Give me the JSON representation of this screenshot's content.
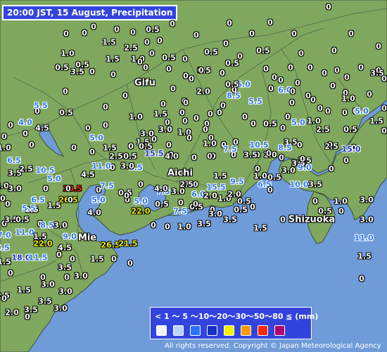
{
  "title": "20:00 JST, 15 August, Precipitation",
  "legend": {
    "text": "< 1 ～ 5 ～10～20～30～50～80 ≦ (mm)",
    "colors": [
      "#f4f4f4",
      "#b9d4ff",
      "#2b74ff",
      "#1830c8",
      "#f5f000",
      "#ff9900",
      "#ff2800",
      "#b4006e"
    ]
  },
  "copyright": "All rights reserved. Copyright © Japan Meteorological Agency",
  "colors": {
    "sea": "#6f9bd8",
    "land": "#7fa85e",
    "border": "#55674a"
  },
  "cities": [
    "Gifu",
    "Aichi",
    "Mie",
    "Shizuoka"
  ],
  "observations": [
    {
      "v": "0",
      "c": "c0"
    },
    {
      "v": "0",
      "c": "c0"
    },
    {
      "v": "0",
      "c": "c0"
    },
    {
      "v": "0",
      "c": "c0"
    },
    {
      "v": "0",
      "c": "c0"
    },
    {
      "v": "0",
      "c": "c0"
    },
    {
      "v": "0",
      "c": "c0"
    },
    {
      "v": "0",
      "c": "c0"
    },
    {
      "v": "1.5",
      "c": "c0"
    },
    {
      "v": "0",
      "c": "c0"
    },
    {
      "v": "0",
      "c": "c0"
    },
    {
      "v": "0.5",
      "c": "c0"
    },
    {
      "v": "0",
      "c": "c0"
    },
    {
      "v": "0",
      "c": "c0"
    },
    {
      "v": "0",
      "c": "c0"
    },
    {
      "v": "0",
      "c": "c0"
    },
    {
      "v": "0",
      "c": "c0"
    },
    {
      "v": "0",
      "c": "c0"
    },
    {
      "v": "1.0",
      "c": "c0"
    },
    {
      "v": "2.5",
      "c": "c0"
    },
    {
      "v": "0",
      "c": "c0"
    },
    {
      "v": "0.5",
      "c": "c0"
    },
    {
      "v": "0",
      "c": "c0"
    },
    {
      "v": "0.5",
      "c": "c0"
    },
    {
      "v": "0",
      "c": "c0"
    },
    {
      "v": "0",
      "c": "c0"
    },
    {
      "v": "0",
      "c": "c0"
    },
    {
      "v": "0.5",
      "c": "c0"
    },
    {
      "v": "0.5",
      "c": "c0"
    },
    {
      "v": "1.5",
      "c": "c0"
    },
    {
      "v": "1.0",
      "c": "c0"
    },
    {
      "v": "0",
      "c": "c0"
    },
    {
      "v": "0",
      "c": "c0"
    },
    {
      "v": "0",
      "c": "c0"
    },
    {
      "v": "0",
      "c": "c0"
    },
    {
      "v": "0.5",
      "c": "c0"
    },
    {
      "v": "0.5",
      "c": "c0"
    },
    {
      "v": "0",
      "c": "c0"
    },
    {
      "v": "0",
      "c": "c0"
    },
    {
      "v": "0",
      "c": "c0"
    },
    {
      "v": "0",
      "c": "c0"
    },
    {
      "v": "0",
      "c": "c0"
    },
    {
      "v": "0",
      "c": "c0"
    },
    {
      "v": "0",
      "c": "c0"
    },
    {
      "v": "0",
      "c": "c0"
    },
    {
      "v": "0",
      "c": "c0"
    },
    {
      "v": "0",
      "c": "c0"
    },
    {
      "v": "0",
      "c": "c0"
    },
    {
      "v": "0",
      "c": "c0"
    },
    {
      "v": "6.0",
      "c": "c5"
    },
    {
      "v": "6.0",
      "c": "c5"
    },
    {
      "v": "0",
      "c": "c0"
    },
    {
      "v": "5.5",
      "c": "c5"
    },
    {
      "v": "0",
      "c": "c0"
    },
    {
      "v": "0",
      "c": "c0"
    },
    {
      "v": "3.5",
      "c": "c0"
    },
    {
      "v": "0",
      "c": "c0"
    },
    {
      "v": "0.5",
      "c": "c0"
    },
    {
      "v": "0",
      "c": "c0"
    },
    {
      "v": "0",
      "c": "c0"
    },
    {
      "v": "0",
      "c": "c0"
    },
    {
      "v": "0",
      "c": "c0"
    },
    {
      "v": "0",
      "c": "c0"
    },
    {
      "v": "0",
      "c": "c0"
    },
    {
      "v": "0",
      "c": "c0"
    },
    {
      "v": "0.5",
      "c": "c0"
    },
    {
      "v": "3.5",
      "c": "c0"
    },
    {
      "v": "0",
      "c": "c0"
    },
    {
      "v": "0",
      "c": "c0"
    },
    {
      "v": "0",
      "c": "c0"
    },
    {
      "v": "0",
      "c": "c0"
    },
    {
      "v": "2.0",
      "c": "c0"
    },
    {
      "v": "8.5",
      "c": "c5"
    },
    {
      "v": "0",
      "c": "c0"
    },
    {
      "v": "0",
      "c": "c0"
    },
    {
      "v": "0",
      "c": "c0"
    },
    {
      "v": "0",
      "c": "c0"
    },
    {
      "v": "0",
      "c": "c0"
    },
    {
      "v": "1.0",
      "c": "c0"
    },
    {
      "v": "0",
      "c": "c0"
    },
    {
      "v": "0",
      "c": "c0"
    },
    {
      "v": "0",
      "c": "c0"
    },
    {
      "v": "0",
      "c": "c0"
    },
    {
      "v": "0.5",
      "c": "c0"
    },
    {
      "v": "0",
      "c": "c0"
    },
    {
      "v": "0",
      "c": "c0"
    },
    {
      "v": "1.5",
      "c": "c0"
    },
    {
      "v": "0",
      "c": "c0"
    },
    {
      "v": "0",
      "c": "c0"
    },
    {
      "v": "0",
      "c": "c0"
    },
    {
      "v": "0",
      "c": "c0"
    },
    {
      "v": "0",
      "c": "c0"
    },
    {
      "v": "0",
      "c": "c0"
    },
    {
      "v": "5.0",
      "c": "c5"
    },
    {
      "v": "5.5",
      "c": "c5"
    },
    {
      "v": "1.0",
      "c": "c0"
    },
    {
      "v": "0",
      "c": "c0"
    },
    {
      "v": "0",
      "c": "c0"
    },
    {
      "v": "0",
      "c": "c0"
    },
    {
      "v": "0",
      "c": "c0"
    },
    {
      "v": "0",
      "c": "c0"
    },
    {
      "v": "0",
      "c": "c0"
    },
    {
      "v": "0",
      "c": "c0"
    },
    {
      "v": "5.0",
      "c": "c5"
    },
    {
      "v": "1.0",
      "c": "c0"
    },
    {
      "v": "2.5",
      "c": "c0"
    },
    {
      "v": "0.5",
      "c": "c0"
    },
    {
      "v": "1.5",
      "c": "c0"
    },
    {
      "v": "0",
      "c": "c0"
    },
    {
      "v": "0",
      "c": "c0"
    },
    {
      "v": "4.0",
      "c": "c5"
    },
    {
      "v": "0",
      "c": "c0"
    },
    {
      "v": "0",
      "c": "c0"
    },
    {
      "v": "3.0",
      "c": "c0"
    },
    {
      "v": "3.0",
      "c": "c0"
    },
    {
      "v": "1.0",
      "c": "c0"
    },
    {
      "v": "0",
      "c": "c0"
    },
    {
      "v": "0",
      "c": "c0"
    },
    {
      "v": "0.5",
      "c": "c0"
    },
    {
      "v": "0",
      "c": "c0"
    },
    {
      "v": "0",
      "c": "c0"
    },
    {
      "v": "4.5",
      "c": "c0"
    },
    {
      "v": "1.5",
      "c": "c0"
    },
    {
      "v": "0.5",
      "c": "c0"
    },
    {
      "v": "0",
      "c": "c0"
    },
    {
      "v": "0",
      "c": "c0"
    },
    {
      "v": "0",
      "c": "c0"
    },
    {
      "v": "0",
      "c": "c0"
    },
    {
      "v": "0",
      "c": "c0"
    },
    {
      "v": "2.5",
      "c": "c0"
    },
    {
      "v": "0",
      "c": "c0"
    },
    {
      "v": "0",
      "c": "c0"
    },
    {
      "v": "5.0",
      "c": "c5"
    },
    {
      "v": "1.5",
      "c": "c0"
    },
    {
      "v": "0",
      "c": "c0"
    },
    {
      "v": "0",
      "c": "c0"
    },
    {
      "v": "0",
      "c": "c0"
    },
    {
      "v": "1.0",
      "c": "c0"
    },
    {
      "v": "0",
      "c": "c0"
    },
    {
      "v": "0",
      "c": "c0"
    },
    {
      "v": "10.5",
      "c": "c5"
    },
    {
      "v": "3.5",
      "c": "c0"
    },
    {
      "v": "0",
      "c": "c0"
    },
    {
      "v": "2.5",
      "c": "c0"
    },
    {
      "v": "0",
      "c": "c0"
    },
    {
      "v": "0",
      "c": "c0"
    },
    {
      "v": "0",
      "c": "c0"
    },
    {
      "v": "2.5",
      "c": "c0"
    },
    {
      "v": "0.5",
      "c": "c0"
    },
    {
      "v": "0",
      "c": "c0"
    },
    {
      "v": "0",
      "c": "c0"
    },
    {
      "v": "0",
      "c": "c0"
    },
    {
      "v": "7.5",
      "c": "c5"
    },
    {
      "v": "3.5",
      "c": "c0"
    },
    {
      "v": "1.0",
      "c": "c0"
    },
    {
      "v": "8.5",
      "c": "c5"
    },
    {
      "v": "3.5",
      "c": "c0"
    },
    {
      "v": "15.0",
      "c": "c10"
    },
    {
      "v": "1.0",
      "c": "c0"
    },
    {
      "v": "0",
      "c": "c0"
    },
    {
      "v": "6.5",
      "c": "c5"
    },
    {
      "v": "0",
      "c": "c0"
    },
    {
      "v": "9.5",
      "c": "c5"
    },
    {
      "v": "15.5",
      "c": "c10"
    },
    {
      "v": "4.0",
      "c": "c0"
    },
    {
      "v": "3.5",
      "c": "c0"
    },
    {
      "v": "2.5",
      "c": "c0"
    },
    {
      "v": "10.5",
      "c": "c5"
    },
    {
      "v": "5.0",
      "c": "c5"
    },
    {
      "v": "30.5",
      "c": "c50"
    },
    {
      "v": "3.0",
      "c": "c0"
    },
    {
      "v": "0",
      "c": "c0"
    },
    {
      "v": "0",
      "c": "c0"
    },
    {
      "v": "0",
      "c": "c0"
    },
    {
      "v": "0",
      "c": "c0"
    },
    {
      "v": "11.0",
      "c": "c5"
    },
    {
      "v": "4.5",
      "c": "c0"
    },
    {
      "v": "2.0",
      "c": "c0"
    },
    {
      "v": "0",
      "c": "c0"
    },
    {
      "v": "0",
      "c": "c0"
    },
    {
      "v": "0",
      "c": "c0"
    },
    {
      "v": "7.5",
      "c": "c5"
    },
    {
      "v": "3.0",
      "c": "c0"
    },
    {
      "v": "3.0",
      "c": "c0"
    },
    {
      "v": "3.5",
      "c": "c0"
    },
    {
      "v": "1.5",
      "c": "c0"
    },
    {
      "v": "3.0",
      "c": "c0"
    },
    {
      "v": "6.5",
      "c": "c5"
    },
    {
      "v": "26.5",
      "c": "c20"
    },
    {
      "v": "0",
      "c": "c0"
    },
    {
      "v": "0.5",
      "c": "c0"
    },
    {
      "v": "4.0",
      "c": "c0"
    },
    {
      "v": "2.5",
      "c": "c0"
    },
    {
      "v": "6.0",
      "c": "c5"
    },
    {
      "v": "15.5",
      "c": "c5"
    },
    {
      "v": "9.5",
      "c": "c5"
    },
    {
      "v": "6.5",
      "c": "c5"
    },
    {
      "v": "10.0",
      "c": "c5"
    },
    {
      "v": "7.5",
      "c": "c5"
    },
    {
      "v": "0",
      "c": "c0"
    },
    {
      "v": "7.5",
      "c": "c5"
    },
    {
      "v": "0.5",
      "c": "c0"
    },
    {
      "v": "2.0",
      "c": "c0"
    },
    {
      "v": "1.0",
      "c": "c0"
    },
    {
      "v": "2.0",
      "c": "c0"
    },
    {
      "v": "0.5",
      "c": "c0"
    },
    {
      "v": "1.0",
      "c": "c0"
    },
    {
      "v": "0.5",
      "c": "c0"
    },
    {
      "v": "3.0",
      "c": "c0"
    },
    {
      "v": "9.0",
      "c": "c5"
    },
    {
      "v": "0",
      "c": "c0"
    },
    {
      "v": "0",
      "c": "c0"
    },
    {
      "v": "0",
      "c": "c0"
    },
    {
      "v": "0",
      "c": "c0"
    },
    {
      "v": "0.5",
      "c": "c0"
    },
    {
      "v": "1.5",
      "c": "c0"
    },
    {
      "v": "0",
      "c": "c0"
    },
    {
      "v": "5.0",
      "c": "c5"
    },
    {
      "v": "0",
      "c": "c0"
    },
    {
      "v": "5.0",
      "c": "c5"
    },
    {
      "v": "0.5",
      "c": "c0"
    },
    {
      "v": "0",
      "c": "c0"
    },
    {
      "v": "0",
      "c": "c0"
    },
    {
      "v": "0",
      "c": "c0"
    },
    {
      "v": "0.5",
      "c": "c0"
    },
    {
      "v": "0",
      "c": "c0"
    },
    {
      "v": "0",
      "c": "c0"
    },
    {
      "v": "3.5",
      "c": "c0"
    },
    {
      "v": "5.5",
      "c": "c5"
    },
    {
      "v": "0",
      "c": "c0"
    },
    {
      "v": "0",
      "c": "c0"
    },
    {
      "v": "8.5",
      "c": "c5"
    },
    {
      "v": "3.0",
      "c": "c0"
    },
    {
      "v": "4.0",
      "c": "c0"
    },
    {
      "v": "22.0",
      "c": "c20"
    },
    {
      "v": "0",
      "c": "c0"
    },
    {
      "v": "0",
      "c": "c0"
    },
    {
      "v": "1.0",
      "c": "c0"
    },
    {
      "v": "3.5",
      "c": "c0"
    },
    {
      "v": "3.0",
      "c": "c0"
    },
    {
      "v": "3.5",
      "c": "c0"
    },
    {
      "v": "1.5",
      "c": "c0"
    },
    {
      "v": "0",
      "c": "c0"
    },
    {
      "v": "0",
      "c": "c0"
    },
    {
      "v": "0.5",
      "c": "c0"
    },
    {
      "v": "1.0",
      "c": "c0"
    },
    {
      "v": "0",
      "c": "c0"
    },
    {
      "v": "3.0",
      "c": "c0"
    },
    {
      "v": "3.0",
      "c": "c0"
    },
    {
      "v": "3.5",
      "c": "c0"
    },
    {
      "v": "0.5",
      "c": "c0"
    },
    {
      "v": "11.0",
      "c": "c5"
    },
    {
      "v": "1.5",
      "c": "c0"
    },
    {
      "v": "22.0",
      "c": "c20"
    },
    {
      "v": "4.5",
      "c": "c0"
    },
    {
      "v": "9.0",
      "c": "c5"
    },
    {
      "v": "26.5",
      "c": "c20"
    },
    {
      "v": "21.5",
      "c": "c20"
    },
    {
      "v": "11.0",
      "c": "c5"
    },
    {
      "v": "1.5",
      "c": "c0"
    },
    {
      "v": "7.0",
      "c": "c5"
    },
    {
      "v": "9.5",
      "c": "c5"
    },
    {
      "v": "18.0",
      "c": "c10"
    },
    {
      "v": "11.5",
      "c": "c5"
    },
    {
      "v": "0",
      "c": "c0"
    },
    {
      "v": "0",
      "c": "c0"
    },
    {
      "v": "1.5",
      "c": "c0"
    },
    {
      "v": "0",
      "c": "c0"
    },
    {
      "v": "0",
      "c": "c0"
    },
    {
      "v": "0",
      "c": "c0"
    },
    {
      "v": "1.5",
      "c": "c0"
    },
    {
      "v": "0",
      "c": "c0"
    },
    {
      "v": "0",
      "c": "c0"
    },
    {
      "v": "0",
      "c": "c0"
    },
    {
      "v": "3.5",
      "c": "c0"
    },
    {
      "v": "3.0",
      "c": "c0"
    },
    {
      "v": "2.5",
      "c": "c0"
    },
    {
      "v": "3.0",
      "c": "c0"
    },
    {
      "v": "3.0",
      "c": "c0"
    },
    {
      "v": "2.0",
      "c": "c0"
    },
    {
      "v": "1.5",
      "c": "c0"
    },
    {
      "v": "3.5",
      "c": "c0"
    },
    {
      "v": "3.5",
      "c": "c0"
    },
    {
      "v": "3.0",
      "c": "c0"
    },
    {
      "v": "0",
      "c": "c0"
    },
    {
      "v": "0",
      "c": "c0"
    }
  ]
}
